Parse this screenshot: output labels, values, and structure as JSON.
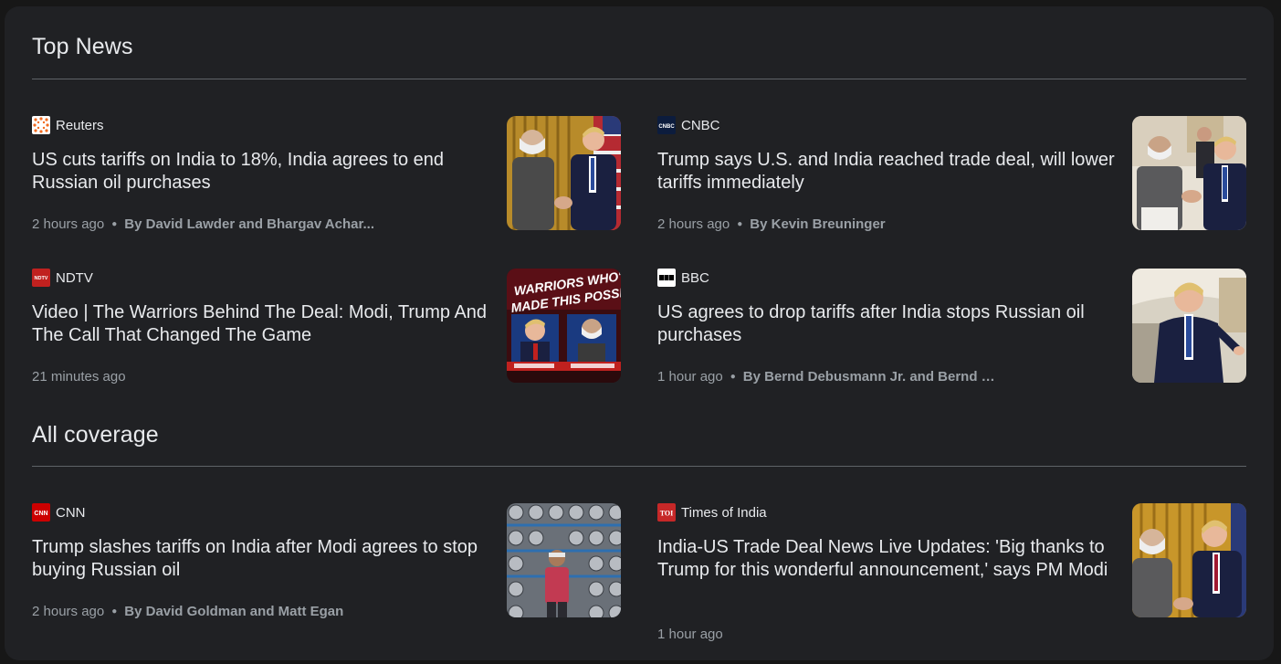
{
  "sections": {
    "top_news": {
      "title": "Top News"
    },
    "all_coverage": {
      "title": "All coverage"
    }
  },
  "articles": [
    {
      "source": "Reuters",
      "source_icon": "reuters-logo-icon",
      "headline": "US cuts tariffs on India to 18%, India agrees to end Russian oil purchases",
      "time": "2 hours ago",
      "author": "By David Lawder and Bhargav Achar...",
      "thumbnail": "modi-trump-handshake-image"
    },
    {
      "source": "CNBC",
      "source_icon": "cnbc-logo-icon",
      "headline": "Trump says U.S. and India reached trade deal, will lower tariffs immediately",
      "time": "2 hours ago",
      "author": "By Kevin Breuninger",
      "thumbnail": "modi-trump-seated-handshake-image"
    },
    {
      "source": "NDTV",
      "source_icon": "ndtv-logo-icon",
      "headline": "Video | The Warriors Behind The Deal: Modi, Trump And The Call That Changed The Game",
      "time": "21 minutes ago",
      "author": "",
      "thumbnail": "ndtv-video-thumbnail",
      "thumb_text_line1": "WARRIORS WHO'VE",
      "thumb_text_line2": "MADE THIS POSSIBLE"
    },
    {
      "source": "BBC",
      "source_icon": "bbc-logo-icon",
      "headline": "US agrees to drop tariffs after India stops Russian oil purchases",
      "time": "1 hour ago",
      "author": "By Bernd Debusmann Jr. and Bernd D...",
      "thumbnail": "trump-portrait-image"
    },
    {
      "source": "CNN",
      "source_icon": "cnn-logo-icon",
      "headline": "Trump slashes tariffs on India after Modi agrees to stop buying Russian oil",
      "time": "2 hours ago",
      "author": "By David Goldman and Matt Egan",
      "thumbnail": "textile-factory-image"
    },
    {
      "source": "Times of India",
      "source_icon": "toi-logo-icon",
      "headline": "India-US Trade Deal News Live Updates: 'Big thanks to Trump for this wonderful announcement,' says PM Modi",
      "time": "1 hour ago",
      "author": "",
      "thumbnail": "modi-trump-handshake-image-2"
    }
  ],
  "colors": {
    "background": "#202124",
    "text": "#e8eaed",
    "muted": "#9aa0a6",
    "divider": "#5f6368"
  }
}
